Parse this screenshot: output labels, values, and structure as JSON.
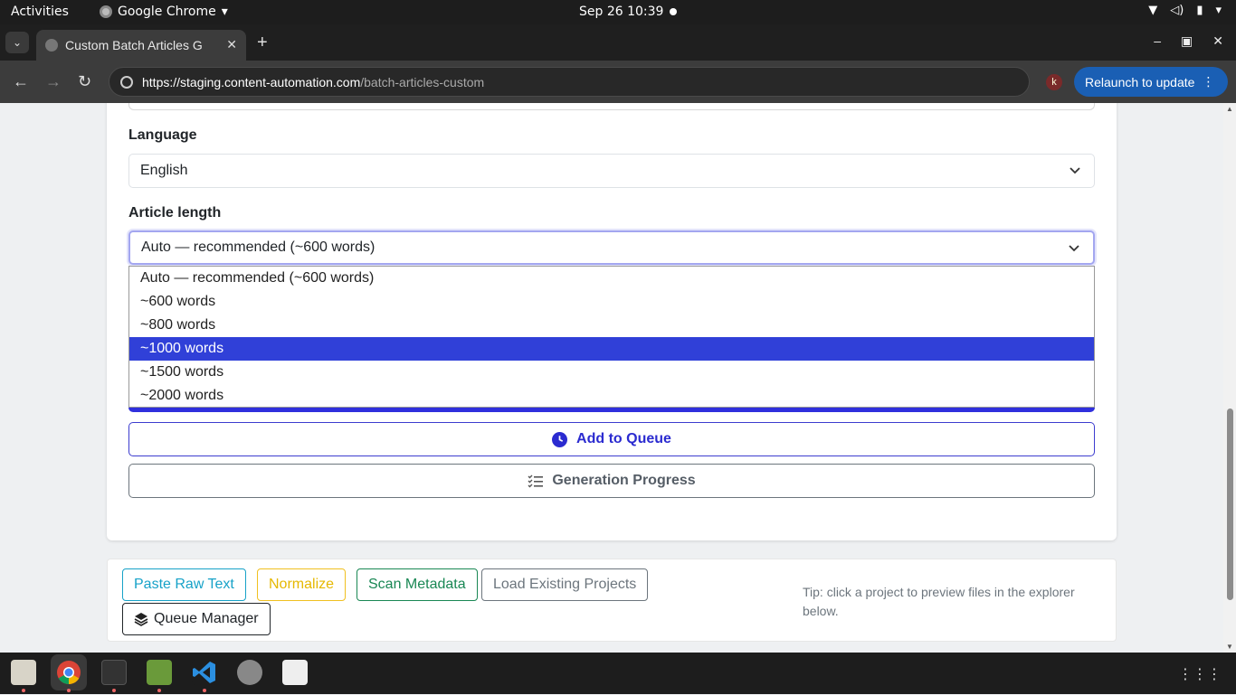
{
  "system": {
    "activities": "Activities",
    "app_name": "Google Chrome",
    "clock": "Sep 26  10:39"
  },
  "browser": {
    "tab_title": "Custom Batch Articles G",
    "url_domain": "https://staging.content-automation.com",
    "url_path": "/batch-articles-custom",
    "profile_initial": "k",
    "relaunch_label": "Relaunch to update"
  },
  "form": {
    "language_label": "Language",
    "language_value": "English",
    "length_label": "Article length",
    "length_value": "Auto — recommended (~600 words)",
    "length_options": [
      "Auto — recommended (~600 words)",
      "~600 words",
      "~800 words",
      "~1000 words",
      "~1500 words",
      "~2000 words"
    ],
    "highlighted_option": "~1000 words",
    "add_to_queue_label": "Add to Queue",
    "generation_progress_label": "Generation Progress"
  },
  "toolbar": {
    "paste_raw_text": "Paste Raw Text",
    "normalize": "Normalize",
    "scan_metadata": "Scan Metadata",
    "load_existing_projects": "Load Existing Projects",
    "queue_manager": "Queue Manager",
    "tip": "Tip: click a project to preview files in the explorer below."
  },
  "colors": {
    "accent": "#2b2bd0",
    "option_highlight": "#3040d8",
    "paste_raw_text": "#17a2c8",
    "normalize": "#f0c020",
    "scan_metadata": "#198754",
    "relaunch": "#1a5fb4"
  },
  "dock": {
    "apps": [
      "files-icon",
      "chrome-icon",
      "terminal-icon",
      "image-editor-icon",
      "vscode-icon",
      "settings-icon",
      "app-icon"
    ]
  }
}
